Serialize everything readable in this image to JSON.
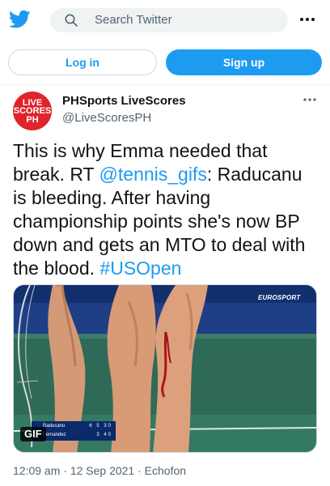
{
  "header": {
    "logo": "twitter-bird-icon",
    "search_placeholder": "Search Twitter",
    "more_icon": "more-horizontal-icon"
  },
  "auth": {
    "login_label": "Log in",
    "signup_label": "Sign up"
  },
  "tweet": {
    "avatar_lines": [
      "LIVE",
      "SCORES",
      "PH"
    ],
    "display_name": "PHSports LiveScores",
    "handle": "@LiveScoresPH",
    "text_before_mention": "This is why Emma needed that break. RT ",
    "mention": "@tennis_gifs",
    "text_after_mention": ": Raducanu is bleeding. After having championship points she's now BP down and gets an MTO to deal with the blood. ",
    "hashtag": "#USOpen",
    "media": {
      "badge": "GIF",
      "watermark": "EUROSPORT",
      "scoreboard": [
        {
          "player": "Raducanu",
          "score": "6 5 30"
        },
        {
          "player": "Fernandez",
          "score": "3 40"
        }
      ]
    },
    "timestamp": "12:09 am · 12 Sep 2021 · Echofon"
  },
  "colors": {
    "accent": "#1d9bf0",
    "text": "#0f1419",
    "muted": "#536471",
    "avatar_bg": "#e0242b"
  }
}
